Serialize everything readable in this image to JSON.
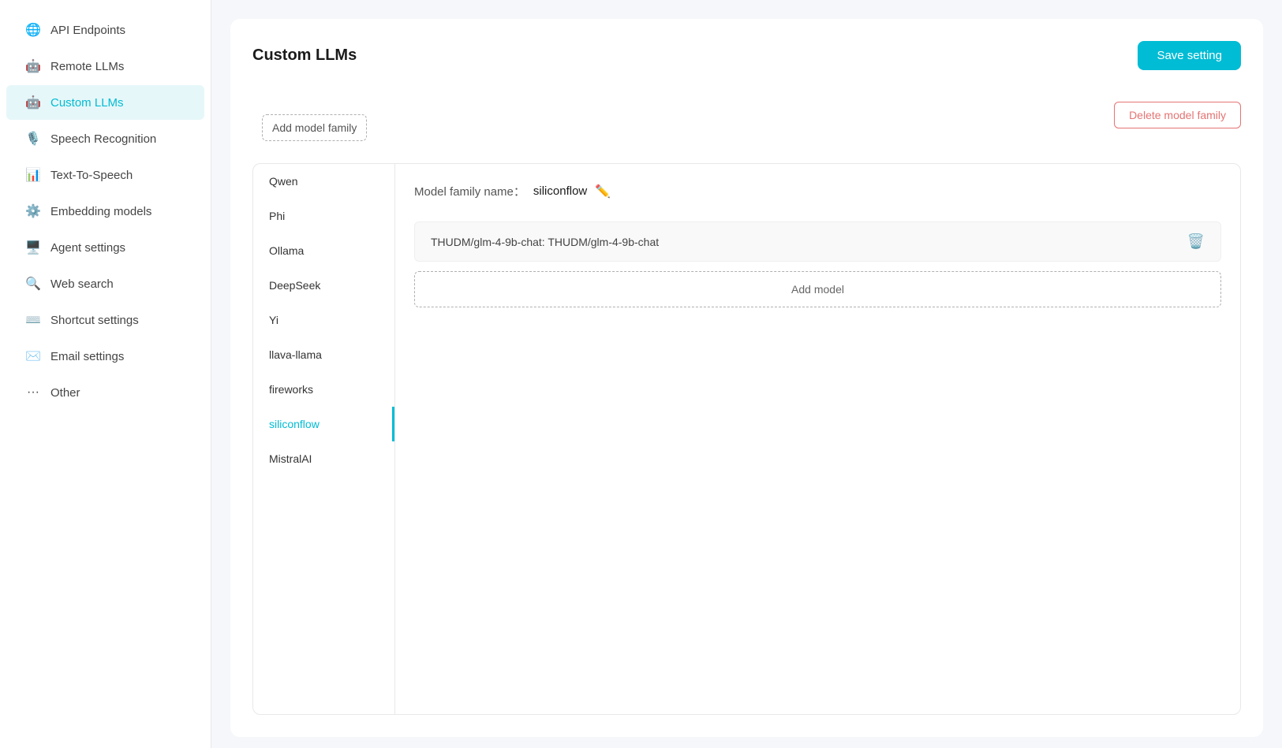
{
  "sidebar": {
    "items": [
      {
        "id": "api-endpoints",
        "label": "API Endpoints",
        "icon": "🌐",
        "active": false
      },
      {
        "id": "remote-llms",
        "label": "Remote LLMs",
        "icon": "🤖",
        "active": false
      },
      {
        "id": "custom-llms",
        "label": "Custom LLMs",
        "icon": "🤖",
        "active": true
      },
      {
        "id": "speech-recognition",
        "label": "Speech Recognition",
        "icon": "🎙️",
        "active": false
      },
      {
        "id": "text-to-speech",
        "label": "Text-To-Speech",
        "icon": "📊",
        "active": false
      },
      {
        "id": "embedding-models",
        "label": "Embedding models",
        "icon": "⚙️",
        "active": false
      },
      {
        "id": "agent-settings",
        "label": "Agent settings",
        "icon": "🖥️",
        "active": false
      },
      {
        "id": "web-search",
        "label": "Web search",
        "icon": "🔍",
        "active": false
      },
      {
        "id": "shortcut-settings",
        "label": "Shortcut settings",
        "icon": "⌨️",
        "active": false
      },
      {
        "id": "email-settings",
        "label": "Email settings",
        "icon": "✉️",
        "active": false
      },
      {
        "id": "other",
        "label": "Other",
        "icon": "···",
        "active": false
      }
    ]
  },
  "header": {
    "title": "Custom LLMs",
    "save_button_label": "Save setting"
  },
  "add_model_family_label": "Add model family",
  "delete_model_family_label": "Delete model family",
  "model_families": [
    {
      "id": "qwen",
      "name": "Qwen",
      "active": false
    },
    {
      "id": "phi",
      "name": "Phi",
      "active": false
    },
    {
      "id": "ollama",
      "name": "Ollama",
      "active": false
    },
    {
      "id": "deepseek",
      "name": "DeepSeek",
      "active": false
    },
    {
      "id": "yi",
      "name": "Yi",
      "active": false
    },
    {
      "id": "llava-llama",
      "name": "llava-llama",
      "active": false
    },
    {
      "id": "fireworks",
      "name": "fireworks",
      "active": false
    },
    {
      "id": "siliconflow",
      "name": "siliconflow",
      "active": true
    },
    {
      "id": "mistralai",
      "name": "MistralAI",
      "active": false
    }
  ],
  "detail": {
    "family_name_label": "Model family name：",
    "family_name_value": "siliconflow",
    "models": [
      {
        "id": "model-1",
        "text": "THUDM/glm-4-9b-chat: THUDM/glm-4-9b-chat"
      }
    ],
    "add_model_label": "Add model"
  }
}
